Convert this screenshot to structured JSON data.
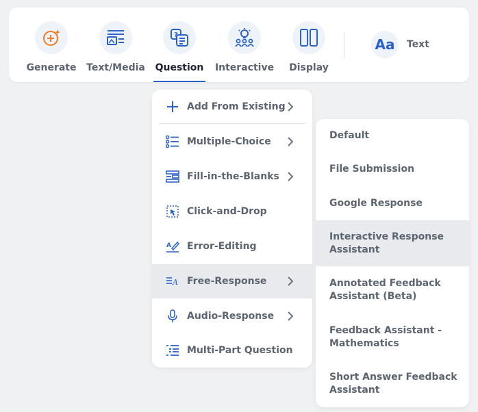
{
  "toolbar": {
    "tools": [
      {
        "label": "Generate",
        "icon": "sparkle-plus-icon"
      },
      {
        "label": "Text/Media",
        "icon": "text-media-icon"
      },
      {
        "label": "Question",
        "icon": "question-doc-icon",
        "active": true
      },
      {
        "label": "Interactive",
        "icon": "lightbulb-people-icon"
      },
      {
        "label": "Display",
        "icon": "columns-icon"
      }
    ],
    "text_tool": {
      "glyph": "Aa",
      "label": "Text"
    }
  },
  "question_menu": {
    "items": [
      {
        "label": "Add From Existing",
        "icon": "plus-icon",
        "has_submenu": true
      },
      {
        "label": "Multiple-Choice",
        "icon": "list-icon",
        "has_submenu": true
      },
      {
        "label": "Fill-in-the-Blanks",
        "icon": "blanks-icon",
        "has_submenu": true
      },
      {
        "label": "Click-and-Drop",
        "icon": "drag-drop-icon",
        "has_submenu": false
      },
      {
        "label": "Error-Editing",
        "icon": "edit-pen-icon",
        "has_submenu": false
      },
      {
        "label": "Free-Response",
        "icon": "free-text-icon",
        "has_submenu": true,
        "highlighted": true
      },
      {
        "label": "Audio-Response",
        "icon": "microphone-icon",
        "has_submenu": true
      },
      {
        "label": "Multi-Part Question",
        "icon": "multipart-icon",
        "has_submenu": false
      }
    ]
  },
  "free_response_submenu": {
    "items": [
      {
        "label": "Default"
      },
      {
        "label": "File Submission"
      },
      {
        "label": "Google Response"
      },
      {
        "label": "Interactive Response Assistant",
        "highlighted": true
      },
      {
        "label": "Annotated Feedback Assistant (Beta)"
      },
      {
        "label": "Feedback Assistant - Mathematics"
      },
      {
        "label": "Short Answer Feedback Assistant"
      }
    ]
  },
  "colors": {
    "accent": "#2a62c9",
    "generate_orange": "#f07a22",
    "highlight": "#e8eaed",
    "text": "#5c6470",
    "background": "#f0f1f3"
  }
}
